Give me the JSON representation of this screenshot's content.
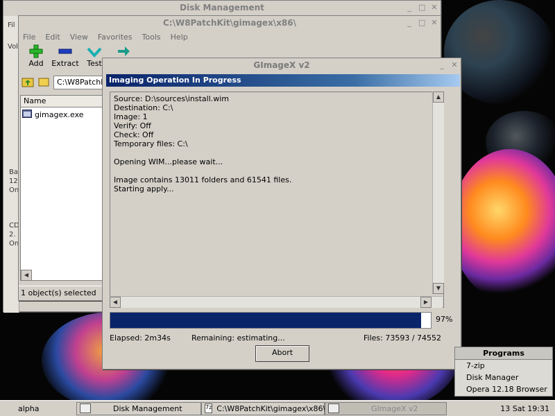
{
  "desktop": {},
  "disk_management": {
    "title": "Disk Management",
    "menu_fragment": "Fil",
    "side_labels": [
      "Vol",
      "Ba",
      "12",
      "On",
      "CD",
      "2.",
      "On"
    ]
  },
  "explorer": {
    "title": "C:\\W8PatchKit\\gimagex\\x86\\",
    "menu": [
      "File",
      "Edit",
      "View",
      "Favorites",
      "Tools",
      "Help"
    ],
    "toolbar": {
      "add": "Add",
      "extract": "Extract",
      "test": "Test"
    },
    "address": "C:\\W8PatchKit",
    "column_name": "Name",
    "files": [
      {
        "name": "gimagex.exe"
      }
    ],
    "status": "1 object(s) selected"
  },
  "gimagex": {
    "title": "GImageX v2",
    "header": "Imaging Operation In Progress",
    "log": [
      "Source: D:\\sources\\install.wim",
      "Destination: C:\\",
      "Image: 1",
      "Verify: Off",
      "Check: Off",
      "Temporary files: C:\\",
      "",
      "Opening WIM...please wait...",
      "",
      "Image contains 13011 folders and 61541 files.",
      "Starting apply..."
    ],
    "progress_percent": 97,
    "progress_label": "97%",
    "elapsed": "Elapsed: 2m34s",
    "remaining": "Remaining: estimating...",
    "files": "Files: 73593 / 74552",
    "abort_label": "Abort"
  },
  "programs": {
    "title": "Programs",
    "items": [
      "7-zip",
      "Disk Manager",
      "Opera 12.18 Browser"
    ]
  },
  "taskbar": {
    "start_label": "alpha",
    "tasks": [
      "Disk Management",
      "C:\\W8PatchKit\\gimagex\\x86\\",
      "GImageX v2"
    ],
    "clock": "13 Sat 19:31"
  }
}
